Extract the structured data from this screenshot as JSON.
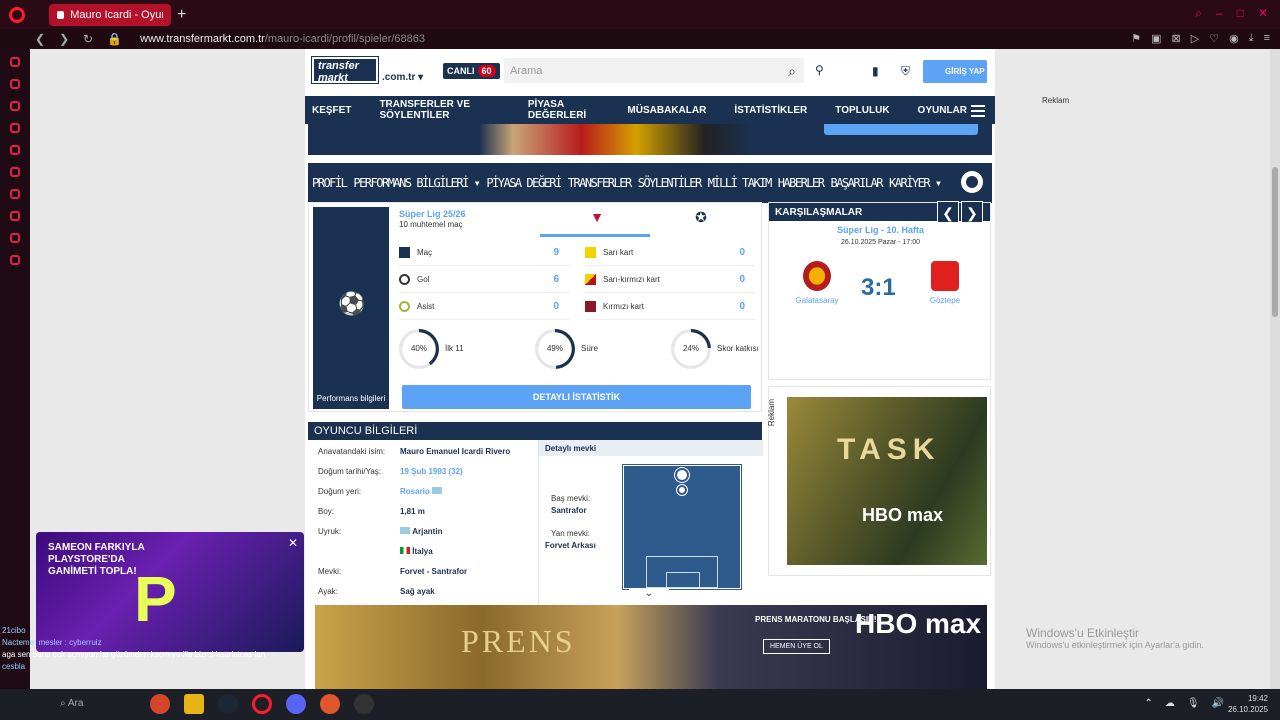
{
  "browser": {
    "tab_title": "Mauro Icardi - Oyuncu pro",
    "url_host": "www.transfermarkt.com.tr",
    "url_path": "/mauro-icardi/profil/spieler/68863",
    "plus": "+"
  },
  "header": {
    "logo": "transfer markt",
    "domain": ".com.tr",
    "live_label": "CANLI",
    "live_count": "60",
    "search_placeholder": "Arama",
    "login": "GİRİŞ YAP"
  },
  "menu": [
    "KEŞFET",
    "TRANSFERLER VE SÖYLENTİLER",
    "PİYASA DEĞERLERİ",
    "MÜSABAKALAR",
    "İSTATİSTİKLER",
    "TOPLULUK",
    "OYUNLAR"
  ],
  "subnav": [
    "PROFİL",
    "PERFORMANS BİLGİLERİ ▾",
    "PİYASA DEĞERİ",
    "TRANSFERLER",
    "SÖYLENTİLER",
    "MİLLİ TAKIM",
    "HABERLER",
    "BAŞARILAR",
    "KARİYER ▾"
  ],
  "performance": {
    "card_label": "Performans bilgileri",
    "league": "Süper Lig 25/26",
    "matches_note": "10 muhtemel maç",
    "stats_left": [
      {
        "label": "Maç",
        "value": "9"
      },
      {
        "label": "Gol",
        "value": "6"
      },
      {
        "label": "Asist",
        "value": "0"
      }
    ],
    "stats_right": [
      {
        "label": "Sarı kart",
        "value": "0"
      },
      {
        "label": "Sarı-kırmızı kart",
        "value": "0"
      },
      {
        "label": "Kırmızı kart",
        "value": "0"
      }
    ],
    "rings": [
      {
        "value": "40%",
        "label": "İlk 11",
        "pct": 40
      },
      {
        "value": "49%",
        "label": "Süre",
        "pct": 49
      },
      {
        "value": "24%",
        "label": "Skor katkısı",
        "pct": 24
      }
    ],
    "detail_button": "DETAYLI İSTATİSTİK"
  },
  "matches": {
    "title": "KARŞILAŞMALAR",
    "prev": "❮",
    "next": "❯",
    "league": "Süper Lig - 10. Hafta",
    "date": "26.10.2025 Pazar - 17:00",
    "score": "3:1",
    "home": "Galatasaray",
    "away": "Göztepe"
  },
  "ad_side": {
    "label": "Reklam",
    "title": "TASK",
    "brand": "HBO max"
  },
  "player_info": {
    "title": "OYUNCU BİLGİLERİ",
    "rows": [
      {
        "label": "Anavatandaki isim:",
        "value": "Mauro Emanuel Icardi Rivero"
      },
      {
        "label": "Doğum tarihi/Yaş:",
        "value": "19 Şub 1993 (32)"
      },
      {
        "label": "Doğum yeri:",
        "value": "Rosario"
      },
      {
        "label": "Boy:",
        "value": "1,81 m"
      },
      {
        "label": "Uyruk:",
        "value": "Arjantin"
      },
      {
        "label": "",
        "value": "İtalya"
      },
      {
        "label": "Mevki:",
        "value": "Forvet - Santrafor"
      },
      {
        "label": "Ayak:",
        "value": "Sağ ayak"
      }
    ],
    "position_title": "Detaylı mevki",
    "main_pos_label": "Baş mevki:",
    "main_pos": "Santrafor",
    "side_pos_label": "Yan mevki:",
    "side_pos": "Forvet Arkası"
  },
  "ad_bottom": {
    "title": "PRENS",
    "line1": "PRENS MARATONU BAŞLASIN!",
    "cta": "HEMEN ÜYE OL",
    "brand": "HBO max"
  },
  "page_reklam": "Reklam",
  "watermark": {
    "title": "Windows'u Etkinleştir",
    "sub": "Windows'u etkinleştirmek için Ayarlar'a gidin."
  },
  "overlay": {
    "line1": "SAMEON FARKIYLA",
    "line2": "PLAYSTORE'DA",
    "line3": "GANİMETİ TOPLA!",
    "close": "✕"
  },
  "chat": [
    {
      "user": "21cibo",
      "msg": ""
    },
    {
      "user": "Nacteme",
      "msg": "Nacteme: mesler : cyberruiz"
    },
    {
      "user": "Raiden",
      "msg": "aga sen bunu çok açmıyon ha gözümden kaçmıyo illa bizmi hatırlatcaz lan"
    },
    {
      "user": "cesbla",
      "msg": ""
    }
  ],
  "taskbar": {
    "search": "Ara",
    "time": "19:42",
    "date": "26.10.2025"
  }
}
